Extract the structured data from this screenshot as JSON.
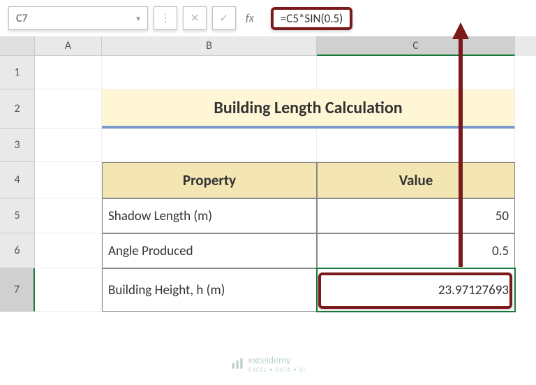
{
  "formula_bar": {
    "cell_ref": "C7",
    "fx_label": "fx",
    "formula": "=C5*SIN(0.5)"
  },
  "columns": [
    "",
    "A",
    "B",
    "C"
  ],
  "rows": [
    "1",
    "2",
    "3",
    "4",
    "5",
    "6",
    "7"
  ],
  "title": "Building Length Calculation",
  "table": {
    "header": {
      "col1": "Property",
      "col2": "Value"
    },
    "rows": [
      {
        "property": "Shadow Length (m)",
        "value": "50"
      },
      {
        "property": "Angle Produced",
        "value": "0.5"
      },
      {
        "property": "Building Height, h (m)",
        "value": "23.97127693"
      }
    ]
  },
  "watermark": {
    "name": "exceldemy",
    "tagline": "EXCEL • DATA • BI"
  },
  "colors": {
    "highlight_border": "#7a1a1a",
    "title_bg": "#fff6d6",
    "title_underline": "#7a9acc",
    "header_bg": "#f3e6b3",
    "selection": "#1a7a3a"
  }
}
